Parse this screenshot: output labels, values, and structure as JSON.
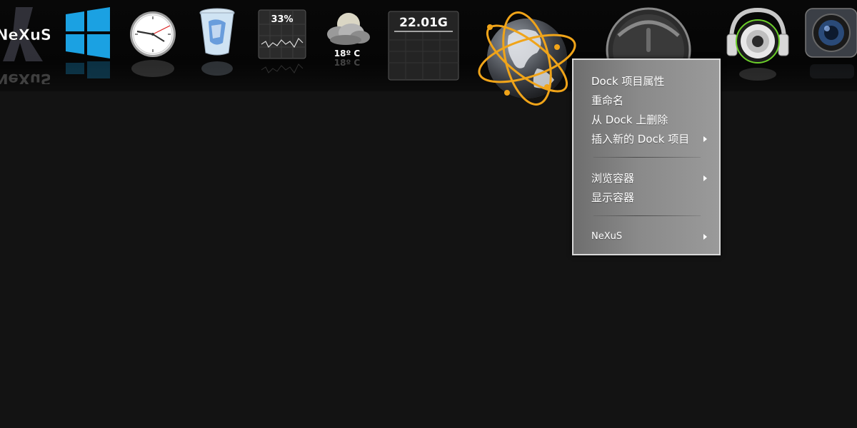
{
  "dock": {
    "items": [
      {
        "name": "nexus-logo",
        "label": "NeXuS"
      },
      {
        "name": "windows",
        "label": ""
      },
      {
        "name": "clock",
        "label": ""
      },
      {
        "name": "recycle-bin",
        "label": ""
      },
      {
        "name": "cpu-meter",
        "label": "33%"
      },
      {
        "name": "weather",
        "label": "18º C"
      },
      {
        "name": "disk-meter",
        "label": "22.01G"
      },
      {
        "name": "internet-globe",
        "label": ""
      },
      {
        "name": "power",
        "label": ""
      },
      {
        "name": "music-player",
        "label": ""
      },
      {
        "name": "camera",
        "label": ""
      }
    ]
  },
  "context_menu": {
    "items": [
      {
        "label": "Dock 项目属性",
        "submenu": false
      },
      {
        "label": "重命名",
        "submenu": false
      },
      {
        "label": "从 Dock 上删除",
        "submenu": false
      },
      {
        "label": "插入新的 Dock 项目",
        "submenu": true
      },
      {
        "label": "浏览容器",
        "submenu": true
      },
      {
        "label": "显示容器",
        "submenu": false
      },
      {
        "label": "NeXuS",
        "submenu": true
      }
    ]
  },
  "colors": {
    "desktop_bg": "#131313",
    "windows_blue": "#1ba1e2",
    "globe_orbit": "#f0a419"
  }
}
